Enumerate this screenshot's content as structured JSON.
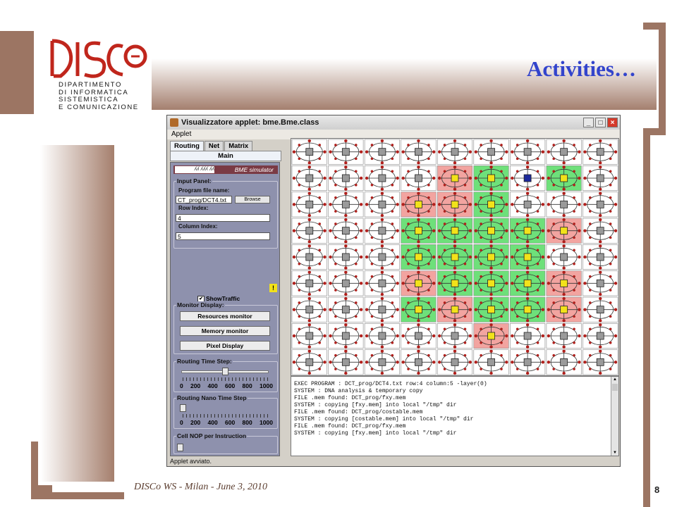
{
  "slide": {
    "title": "Activities…",
    "footer": "DISCo WS - Milan - June 3, 2010",
    "page_number": "8",
    "logo": {
      "lines": [
        "DIPARTIMENTO",
        "DI INFORMATICA",
        "SISTEMISTICA",
        "E COMUNICAZIONE"
      ],
      "brand_color": "#c0261c"
    },
    "accent_color": "#9c7563",
    "title_color": "#3344cc"
  },
  "applet": {
    "window_title": "Visualizzatore applet: bme.Bme.class",
    "menu": "Applet",
    "tabs": [
      "Routing",
      "Net",
      "Matrix"
    ],
    "active_tab": "Routing",
    "sub_tab": "Main",
    "banner": "BME simulator",
    "input_panel": {
      "title": "Input Panel:",
      "program_label": "Program file name:",
      "program_value": "CT_prog/DCT4.txt",
      "browse_label": "Browse",
      "row_label": "Row Index:",
      "row_value": "4",
      "col_label": "Column Index:",
      "col_value": "5"
    },
    "warning_glyph": "!",
    "show_traffic": {
      "label": "ShowTraffic",
      "checked": true
    },
    "monitor": {
      "title": "Monitor Display:",
      "buttons": [
        "Resources monitor",
        "Memory monitor",
        "Pixel Display"
      ]
    },
    "routing_time_step": {
      "title": "Routing Time Step:",
      "ticks": [
        "0",
        "200",
        "400",
        "600",
        "800",
        "1000"
      ],
      "value": 500
    },
    "routing_nano_time_step": {
      "title": "Routing Nano Time Step",
      "ticks": [
        "0",
        "200",
        "400",
        "600",
        "800",
        "1000"
      ],
      "value": 0
    },
    "cell_nop": {
      "title": "Cell NOP per Instruction",
      "value": 0
    },
    "console_lines": [
      "EXEC PROGRAM : DCT_prog/DCT4.txt row:4 column:5 -layer(0)",
      "SYSTEM : DNA analysis & temporary copy",
      "FILE .mem found: DCT_prog/fxy.mem",
      "SYSTEM : copying [fxy.mem] into local \"/tmp\" dir",
      "FILE .mem found: DCT_prog/costable.mem",
      "SYSTEM : copying [costable.mem] into local \"/tmp\" dir",
      "FILE .mem found: DCT_prog/fxy.mem",
      "SYSTEM : copying [fxy.mem] into local \"/tmp\" dir"
    ],
    "status_text": "Applet avviato.",
    "grid": {
      "rows": 9,
      "cols": 9,
      "cell_states": [
        "nnnnnnnnn",
        "nnnnrgbgn",
        "nnnrrgnnn",
        "nnnggggrn",
        "nnnggggnn",
        "nnnrgggrn",
        "nnngrggrn",
        "nnnnnrnnn",
        "nnnnnnnnn"
      ],
      "center_colors": {
        "n": "#9a9a9a",
        "r": "#f2e21a",
        "g": "#f2e21a",
        "b": "#1d2a9c"
      },
      "bg_colors": {
        "n": "#ffffff",
        "r": "#f2a4a0",
        "g": "#6ee07a",
        "b": "#ffffff"
      },
      "node_color": "#b0201c",
      "edge_color": "#333333"
    }
  }
}
